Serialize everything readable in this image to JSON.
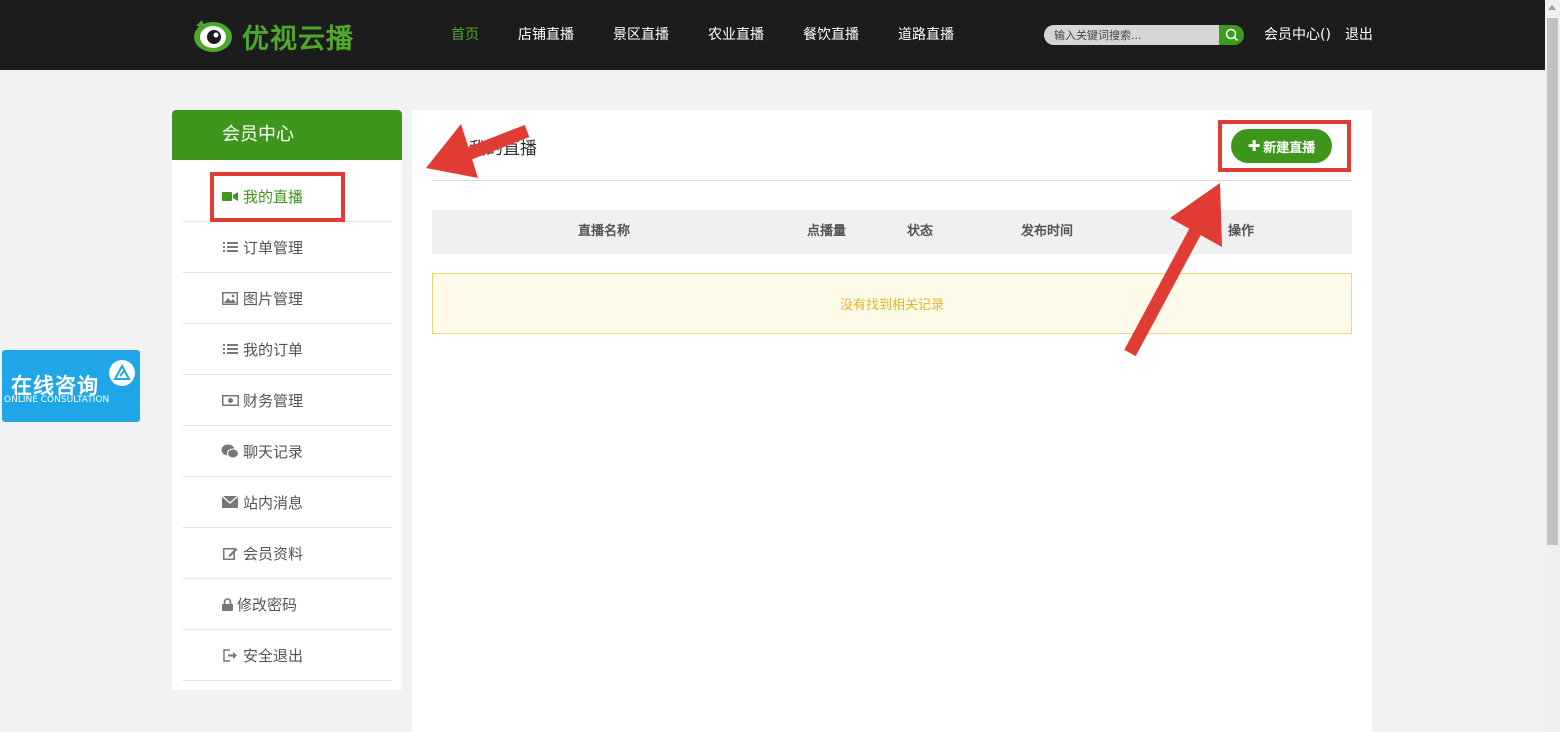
{
  "header": {
    "logo_text": "优视云播",
    "nav": [
      "首页",
      "店铺直播",
      "景区直播",
      "农业直播",
      "餐饮直播",
      "道路直播"
    ],
    "search_placeholder": "输入关键词搜索...",
    "member_center": "会员中心()",
    "logout": "退出"
  },
  "sidebar": {
    "title": "会员中心",
    "items": [
      {
        "label": "我的直播",
        "icon": "video-camera-icon",
        "active": true
      },
      {
        "label": "订单管理",
        "icon": "list-icon"
      },
      {
        "label": "图片管理",
        "icon": "image-icon"
      },
      {
        "label": "我的订单",
        "icon": "list-icon"
      },
      {
        "label": "财务管理",
        "icon": "money-icon"
      },
      {
        "label": "聊天记录",
        "icon": "wechat-icon"
      },
      {
        "label": "站内消息",
        "icon": "envelope-icon"
      },
      {
        "label": "会员资料",
        "icon": "edit-icon"
      },
      {
        "label": "修改密码",
        "icon": "lock-icon"
      },
      {
        "label": "安全退出",
        "icon": "sign-out-icon"
      }
    ]
  },
  "main": {
    "title": "我的直播",
    "new_button": "新建直播",
    "table": {
      "columns": [
        "直播名称",
        "点播量",
        "状态",
        "发布时间",
        "操作"
      ],
      "empty_message": "没有找到相关记录"
    }
  },
  "consult": {
    "cn": "在线咨询",
    "en": "ONLINE CONSULTATION"
  },
  "colors": {
    "topbar": "#1c1c1c",
    "brand_green": "#3f961d",
    "nav_active": "#4ea82a",
    "annotation_red": "#e03c33",
    "consult_blue": "#1ea6e8",
    "empty_bg": "#fffbea",
    "empty_text": "#e1b32a"
  }
}
